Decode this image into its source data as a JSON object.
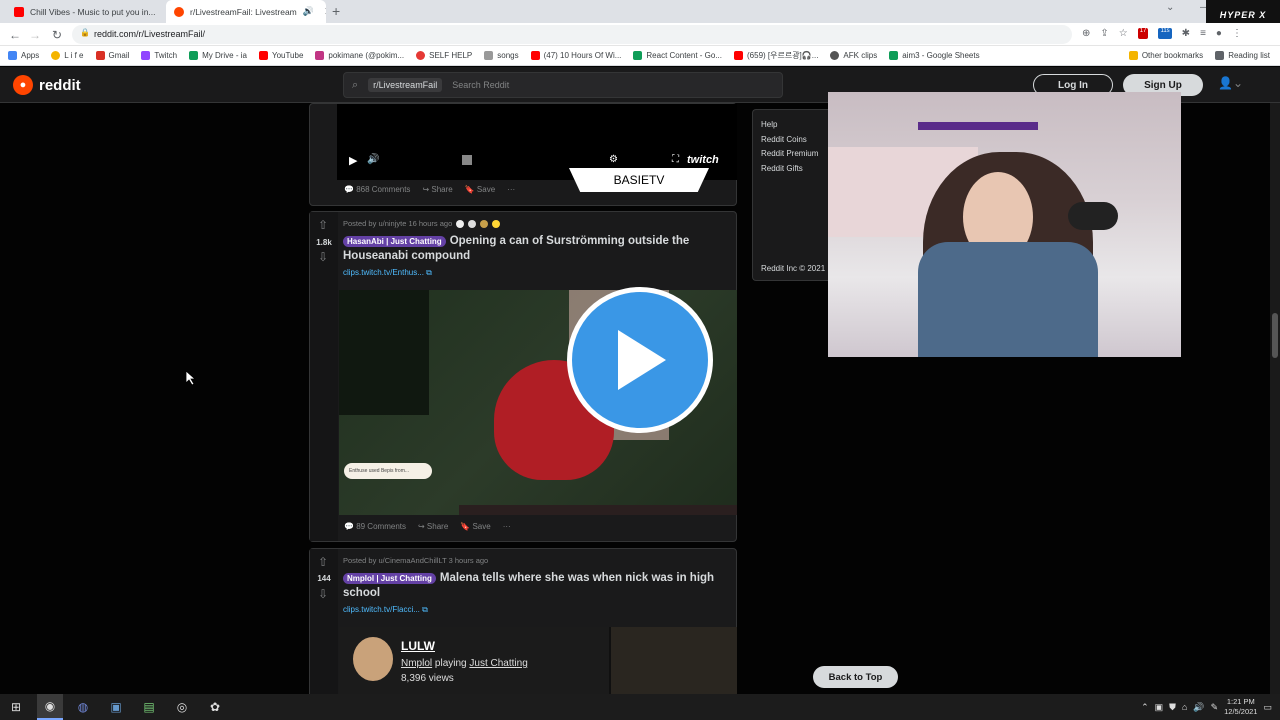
{
  "browser": {
    "tabs": [
      {
        "title": "Chill Vibes - Music to put you in..."
      },
      {
        "title": "r/LivestreamFail: Livestream"
      }
    ],
    "url": "reddit.com/r/LivestreamFail/",
    "bookmarks": [
      "Apps",
      "L i f e",
      "Gmail",
      "Twitch",
      "My Drive - ia",
      "YouTube",
      "pokimane (@pokim...",
      "SELF HELP",
      "songs",
      "(47) 10 Hours Of Wi...",
      "React Content - Go...",
      "(659) [우르르광]🎧...",
      "AFK clips",
      "aim3 - Google Sheets",
      "Other bookmarks",
      "Reading list"
    ],
    "extension_badges": {
      "a": "17",
      "b": "11s"
    },
    "hyperx_overlay": "HYPER X"
  },
  "reddit": {
    "logo_text": "reddit",
    "search_chip": "r/LivestreamFail",
    "search_placeholder": "Search Reddit",
    "login": "Log In",
    "signup": "Sign Up",
    "sidebar_links": [
      "Help",
      "Reddit Coins",
      "Reddit Premium",
      "Reddit Gifts"
    ],
    "copyright": "Reddit Inc © 2021",
    "back_to_top": "Back to Top"
  },
  "posts": [
    {
      "comments": "868 Comments",
      "share": "Share",
      "save": "Save",
      "video_watermark": "BASIETV",
      "video_brand": "twitch"
    },
    {
      "votes": "1.8k",
      "meta": "Posted by u/ninjyte 16 hours ago",
      "flair": "HasanAbi | Just Chatting",
      "title": "Opening a can of Surströmming outside the Houseanabi compound",
      "link": "clips.twitch.tv/Enthus...",
      "comments": "89 Comments",
      "share": "Share",
      "save": "Save",
      "stream_caption": "Enthuse used Bepis from..."
    },
    {
      "votes": "144",
      "meta": "Posted by u/CinemaAndChillLT 3 hours ago",
      "flair": "Nmplol | Just Chatting",
      "title": "Malena tells where she was when nick was in high school",
      "link": "clips.twitch.tv/Flacci...",
      "embed_title": "LULW",
      "embed_channel": "Nmplol",
      "embed_playing": "playing",
      "embed_game": "Just Chatting",
      "embed_views": "8,396 views"
    }
  ],
  "taskbar": {
    "time": "1:21 PM",
    "date": "12/5/2021"
  },
  "colors": {
    "reddit_orange": "#ff4500",
    "twitch_purple": "#6441a5",
    "play_blue": "#3a97e6"
  }
}
